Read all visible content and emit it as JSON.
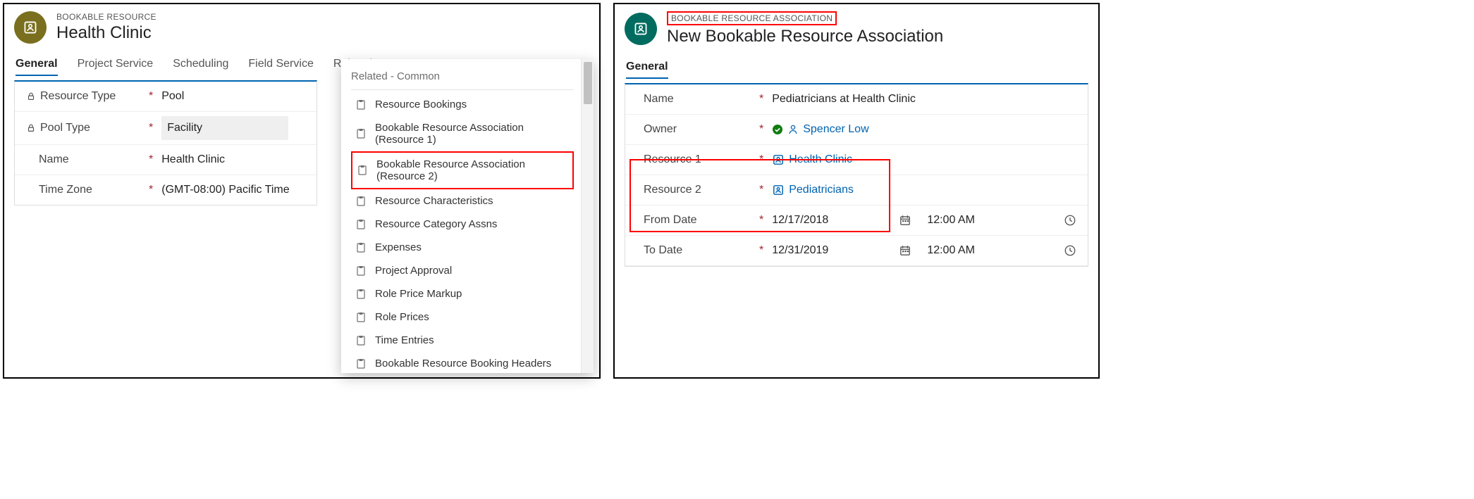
{
  "left": {
    "entity_label": "BOOKABLE RESOURCE",
    "entity_title": "Health Clinic",
    "tabs": [
      "General",
      "Project Service",
      "Scheduling",
      "Field Service",
      "Related"
    ],
    "selected_tab": "General",
    "fields": {
      "resource_type": {
        "label": "Resource Type",
        "value": "Pool",
        "locked": true,
        "required": true
      },
      "pool_type": {
        "label": "Pool Type",
        "value": "Facility",
        "locked": true,
        "required": true
      },
      "name": {
        "label": "Name",
        "value": "Health Clinic",
        "required": true
      },
      "time_zone": {
        "label": "Time Zone",
        "value": "(GMT-08:00) Pacific Time",
        "required": true
      }
    },
    "related_menu": {
      "heading": "Related - Common",
      "items": [
        "Resource Bookings",
        "Bookable Resource Association (Resource 1)",
        "Bookable Resource Association (Resource 2)",
        "Resource Characteristics",
        "Resource Category Assns",
        "Expenses",
        "Project Approval",
        "Role Price Markup",
        "Role Prices",
        "Time Entries",
        "Bookable Resource Booking Headers"
      ],
      "highlighted_index": 2
    }
  },
  "right": {
    "entity_label": "BOOKABLE RESOURCE ASSOCIATION",
    "entity_title": "New Bookable Resource Association",
    "selected_tab": "General",
    "fields": {
      "name": {
        "label": "Name",
        "value": "Pediatricians at Health Clinic",
        "required": true
      },
      "owner": {
        "label": "Owner",
        "value": "Spencer Low",
        "required": true
      },
      "resource1": {
        "label": "Resource 1",
        "value": "Health Clinic",
        "required": true
      },
      "resource2": {
        "label": "Resource 2",
        "value": "Pediatricians",
        "required": true
      },
      "from_date": {
        "label": "From Date",
        "date": "12/17/2018",
        "time": "12:00 AM",
        "required": true
      },
      "to_date": {
        "label": "To Date",
        "date": "12/31/2019",
        "time": "12:00 AM",
        "required": true
      }
    }
  }
}
